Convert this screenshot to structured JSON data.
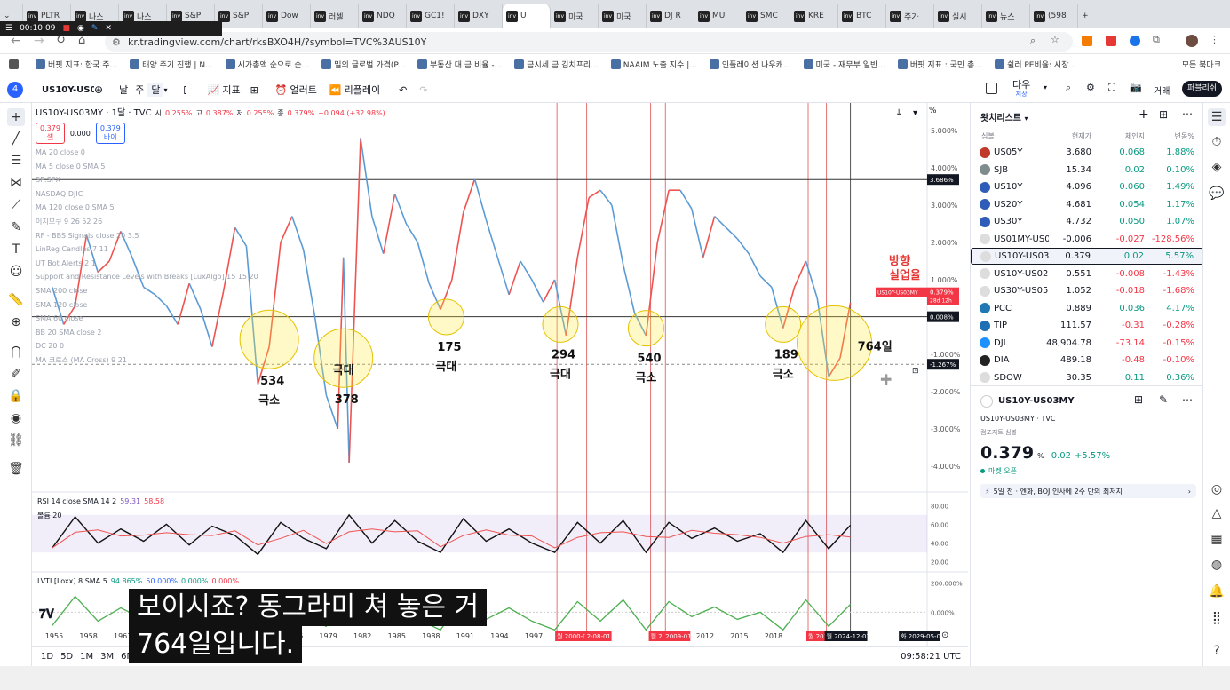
{
  "browser": {
    "tabs": [
      "PLTR",
      "나스",
      "나스",
      "S&P",
      "S&P",
      "Dow",
      "러셀",
      "NDQ",
      "GC1!",
      "DXY",
      "U",
      "미국",
      "미국",
      "DJ R",
      "MU",
      "SMC",
      "KRE",
      "BTC",
      "주가",
      "실시",
      "뉴스",
      "(598"
    ],
    "active_tab_index": 10,
    "url": "kr.tradingview.com/chart/rksBXO4H/?symbol=TVC%3AUS10Y",
    "recorder_time": "00:10:09",
    "bookmarks": [
      "버핏 지표: 한국 주...",
      "태양 주기 진행 | N...",
      "시가총액 순으로 순...",
      "밀의 글로벌 가격(P...",
      "부동산 대 금 비율 -...",
      "금시세 금 김치프리...",
      "NAAIM 노출 지수 |...",
      "인플레이션 나우캐...",
      "미국 - 재무부 일반...",
      "버핏 지표 : 국민 총...",
      "쉴러 PE비율: 시장..."
    ],
    "all_bookmarks": "모든 북마크"
  },
  "toolbar": {
    "symbol": "US10Y-US03M",
    "interval_day": "날",
    "interval_week": "주",
    "interval_month": "달",
    "indicators": "지표",
    "alert": "얼러트",
    "replay": "리플레이",
    "layout_name": "다우",
    "layout_sub": "저장",
    "trade": "거래",
    "publish": "퍼블리쉬"
  },
  "legend": {
    "title": "US10Y-US03MY · 1달 · TVC",
    "o_label": "시",
    "o_val": "0.255%",
    "h_label": "고",
    "h_val": "0.387%",
    "l_label": "저",
    "l_val": "0.255%",
    "c_label": "종",
    "c_val": "0.379%",
    "chg": "+0.094 (+32.98%)",
    "sell_price": "0.379",
    "sell_label": "셀",
    "spread": "0.000",
    "buy_price": "0.379",
    "buy_label": "바이",
    "indicators": [
      "MA 20 close 0",
      "MA 5 close 0 SMA 5",
      "SP:SPX",
      "NASDAQ:DJIC",
      "MA 120 close 0 SMA 5",
      "이치모쿠 9 26 52 26",
      "RF - BBS Signals close 20 3.5",
      "LinReg Candles 7 11",
      "UT Bot Alerts 2 1",
      "Support and Resistance Levels with Breaks [LuxAlgo] 15 15 20",
      "SMA 200 close",
      "SMA 120 close",
      "SMA 60 close",
      "BB 20 SMA close 2",
      "DC 20 0",
      "MA 크로스 (MA Cross) 9 21"
    ]
  },
  "chart_data": {
    "type": "line",
    "x_ticks": [
      "1955",
      "1958",
      "1961",
      "1964",
      "1967",
      "1970",
      "1973",
      "1976",
      "1979",
      "1982",
      "1985",
      "1988",
      "1991",
      "1994",
      "1997",
      "2012",
      "2015",
      "2018"
    ],
    "y_ticks": [
      "5.000%",
      "4.000%",
      "3.000%",
      "2.000%",
      "1.000%",
      "0.000%",
      "-1.000%",
      "-2.000%",
      "-3.000%",
      "-4.000%"
    ],
    "ylim": [
      -4.5,
      5.5
    ],
    "xlim": [
      1954,
      2031
    ],
    "price_labels": {
      "top_line": "3.686%",
      "current": "0.379%",
      "current_sym": "US10Y-US03MY",
      "countdown": "28d 12h",
      "zero": "0.008%",
      "cursor": "-1.267%"
    },
    "spread_series": [
      [
        1955,
        0.8
      ],
      [
        1956,
        -0.2
      ],
      [
        1957,
        0.3
      ],
      [
        1958,
        2.2
      ],
      [
        1959,
        1.2
      ],
      [
        1960,
        1.5
      ],
      [
        1961,
        2.3
      ],
      [
        1962,
        1.6
      ],
      [
        1963,
        0.8
      ],
      [
        1964,
        0.6
      ],
      [
        1965,
        0.3
      ],
      [
        1966,
        -0.2
      ],
      [
        1967,
        0.9
      ],
      [
        1968,
        0.2
      ],
      [
        1969,
        -0.8
      ],
      [
        1970,
        0.7
      ],
      [
        1971,
        2.4
      ],
      [
        1972,
        1.9
      ],
      [
        1973,
        -1.8
      ],
      [
        1974,
        -0.8
      ],
      [
        1975,
        2.0
      ],
      [
        1976,
        2.7
      ],
      [
        1977,
        1.8
      ],
      [
        1978,
        0.0
      ],
      [
        1979,
        -2.1
      ],
      [
        1980,
        -3.0
      ],
      [
        1980.5,
        1.6
      ],
      [
        1981,
        -3.9
      ],
      [
        1982,
        4.8
      ],
      [
        1983,
        2.7
      ],
      [
        1984,
        1.7
      ],
      [
        1985,
        3.3
      ],
      [
        1986,
        2.5
      ],
      [
        1987,
        2.0
      ],
      [
        1988,
        0.9
      ],
      [
        1989,
        0.2
      ],
      [
        1990,
        1.0
      ],
      [
        1991,
        2.8
      ],
      [
        1992,
        3.7
      ],
      [
        1993,
        2.6
      ],
      [
        1994,
        1.6
      ],
      [
        1995,
        0.6
      ],
      [
        1996,
        1.5
      ],
      [
        1997,
        1.0
      ],
      [
        1998,
        0.4
      ],
      [
        1999,
        1.0
      ],
      [
        2000,
        -0.5
      ],
      [
        2001,
        1.6
      ],
      [
        2002,
        3.2
      ],
      [
        2003,
        3.4
      ],
      [
        2004,
        3.0
      ],
      [
        2005,
        1.4
      ],
      [
        2006,
        0.1
      ],
      [
        2007,
        -0.5
      ],
      [
        2008,
        2.0
      ],
      [
        2009,
        3.4
      ],
      [
        2010,
        3.4
      ],
      [
        2011,
        2.9
      ],
      [
        2012,
        1.6
      ],
      [
        2013,
        2.7
      ],
      [
        2014,
        2.4
      ],
      [
        2015,
        2.1
      ],
      [
        2016,
        1.7
      ],
      [
        2017,
        1.1
      ],
      [
        2018,
        0.8
      ],
      [
        2019,
        -0.3
      ],
      [
        2020,
        0.8
      ],
      [
        2021,
        1.5
      ],
      [
        2022,
        0.5
      ],
      [
        2023,
        -1.6
      ],
      [
        2024,
        -1.1
      ],
      [
        2024.9,
        0.379
      ]
    ],
    "h_lines": [
      3.686,
      0.008,
      -1.267
    ],
    "circles": [
      {
        "year": 1974,
        "value": -0.6,
        "label_num": "534",
        "label_word": "극소"
      },
      {
        "year": 1980.5,
        "value": -1.1,
        "label_num": "378",
        "label_word": "극대"
      },
      {
        "year": 1989.5,
        "value": 0.0,
        "label_num": "175",
        "label_word": "극대"
      },
      {
        "year": 1999.5,
        "value": -0.2,
        "label_num": "294",
        "label_word": "극대"
      },
      {
        "year": 2007,
        "value": -0.3,
        "label_num": "540",
        "label_word": "극소"
      },
      {
        "year": 2019,
        "value": -0.2,
        "label_num": "189",
        "label_word": "극소"
      },
      {
        "year": 2023.5,
        "value": -0.7,
        "label_num": "764일",
        "label_word": ""
      }
    ],
    "red_vlines": [
      1999.2,
      2001.8,
      2007.4,
      2008.7,
      2021.2,
      2022.8
    ],
    "annotation": {
      "line1": "방향",
      "line2": "실업율"
    },
    "date_labels": [
      "월 2000-01-03",
      "2-08-01",
      "월 2",
      "2009-01-01",
      "월 2021-1",
      "월 2024-12-02",
      "화 2029-05-01"
    ],
    "rsi": {
      "label": "RSI 14 close SMA 14 2",
      "v1": "59.31",
      "v2": "58.58",
      "bb_label": "볼륨 20",
      "ticks": [
        "80.00",
        "60.00",
        "40.00",
        "20.00"
      ],
      "series": [
        [
          1955,
          35
        ],
        [
          1957,
          68
        ],
        [
          1959,
          40
        ],
        [
          1961,
          55
        ],
        [
          1963,
          42
        ],
        [
          1965,
          60
        ],
        [
          1967,
          38
        ],
        [
          1969,
          58
        ],
        [
          1971,
          48
        ],
        [
          1973,
          28
        ],
        [
          1975,
          62
        ],
        [
          1977,
          45
        ],
        [
          1979,
          34
        ],
        [
          1981,
          70
        ],
        [
          1983,
          40
        ],
        [
          1985,
          64
        ],
        [
          1987,
          42
        ],
        [
          1989,
          30
        ],
        [
          1991,
          66
        ],
        [
          1993,
          42
        ],
        [
          1995,
          55
        ],
        [
          1997,
          40
        ],
        [
          1999,
          30
        ],
        [
          2001,
          62
        ],
        [
          2003,
          40
        ],
        [
          2005,
          64
        ],
        [
          2007,
          30
        ],
        [
          2009,
          62
        ],
        [
          2011,
          45
        ],
        [
          2013,
          56
        ],
        [
          2015,
          42
        ],
        [
          2017,
          50
        ],
        [
          2019,
          30
        ],
        [
          2021,
          64
        ],
        [
          2023,
          34
        ],
        [
          2024.9,
          59
        ]
      ]
    },
    "lvti": {
      "label": "LVTI [Loxx] 8 SMA 5",
      "v1": "94.865%",
      "v2": "50.000%",
      "v3": "0.000%",
      "v4": "0.000%",
      "ticks": [
        "200.000%",
        "0.000%"
      ]
    }
  },
  "watchlist": {
    "title": "왓치리스트",
    "col_symbol": "심볼",
    "col_last": "현재가",
    "col_chg": "체인지",
    "col_chgp": "변동%",
    "rows": [
      {
        "sym": "US05Y",
        "last": "3.680",
        "chg": "0.068",
        "chgp": "1.88%",
        "dir": "pos",
        "color": "#c0392b"
      },
      {
        "sym": "SJB",
        "last": "15.34",
        "chg": "0.02",
        "chgp": "0.10%",
        "dir": "pos",
        "color": "#7f8c8d"
      },
      {
        "sym": "US10Y",
        "last": "4.096",
        "chg": "0.060",
        "chgp": "1.49%",
        "dir": "pos",
        "color": "#2e5cb8"
      },
      {
        "sym": "US20Y",
        "last": "4.681",
        "chg": "0.054",
        "chgp": "1.17%",
        "dir": "pos",
        "color": "#2e5cb8"
      },
      {
        "sym": "US30Y",
        "last": "4.732",
        "chg": "0.050",
        "chgp": "1.07%",
        "dir": "pos",
        "color": "#2e5cb8"
      },
      {
        "sym": "US01MY-US0",
        "last": "-0.006",
        "chg": "-0.027",
        "chgp": "-128.56%",
        "dir": "neg",
        "color": "#ddd"
      },
      {
        "sym": "US10Y-US03",
        "last": "0.379",
        "chg": "0.02",
        "chgp": "5.57%",
        "dir": "pos",
        "color": "#ddd"
      },
      {
        "sym": "US10Y-US02",
        "last": "0.551",
        "chg": "-0.008",
        "chgp": "-1.43%",
        "dir": "neg",
        "color": "#ddd"
      },
      {
        "sym": "US30Y-US05",
        "last": "1.052",
        "chg": "-0.018",
        "chgp": "-1.68%",
        "dir": "neg",
        "color": "#ddd"
      },
      {
        "sym": "PCC",
        "last": "0.889",
        "chg": "0.036",
        "chgp": "4.17%",
        "dir": "pos",
        "color": "#1f77b4"
      },
      {
        "sym": "TIP",
        "last": "111.57",
        "chg": "-0.31",
        "chgp": "-0.28%",
        "dir": "neg",
        "color": "#1f6fb4"
      },
      {
        "sym": "DJI",
        "last": "48,904.78",
        "chg": "-73.14",
        "chgp": "-0.15%",
        "dir": "neg",
        "color": "#1e90ff"
      },
      {
        "sym": "DIA",
        "last": "489.18",
        "chg": "-0.48",
        "chgp": "-0.10%",
        "dir": "neg",
        "color": "#222"
      },
      {
        "sym": "SDOW",
        "last": "30.35",
        "chg": "0.11",
        "chgp": "0.36%",
        "dir": "pos",
        "color": "#ddd"
      }
    ],
    "detail": {
      "symbol": "US10Y-US03MY",
      "source": "US10Y-US03MY · TVC",
      "sub": "컴포지트 심볼",
      "price": "0.379",
      "unit": "%",
      "chg": "0.02",
      "chgp": "+5.57%",
      "market": "마켓 오픈",
      "news": "5일 전 · 엔화, BOJ 인사에 2주 만의 최저치"
    }
  },
  "bottom": {
    "ranges": [
      "1D",
      "5D",
      "1M",
      "3M",
      "6M",
      "YTD"
    ],
    "time": "09:58:21 UTC"
  },
  "caption": {
    "line1": "보이시죠? 동그라미 쳐 놓은 거",
    "line2": "764일입니다."
  }
}
